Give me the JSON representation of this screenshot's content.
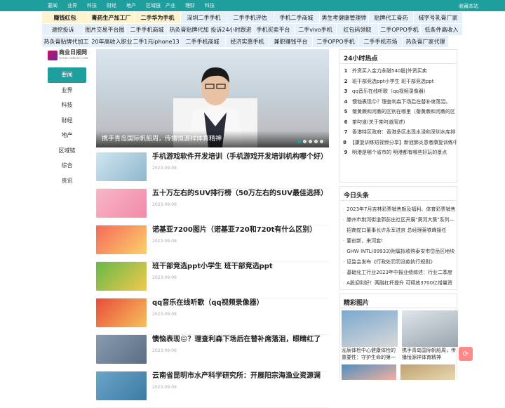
{
  "topbar": {
    "nav": [
      "要闻",
      "业界",
      "科技",
      "财经",
      "地产",
      "区域链",
      "产业",
      "理财",
      "科技"
    ],
    "favorite": "收藏本站"
  },
  "hot_links": [
    [
      {
        "t": "赚钱红包",
        "b": true,
        "w": 66
      },
      {
        "t": "膏药生产加工厂",
        "b": true,
        "w": 66
      },
      {
        "t": "二手华为手机",
        "b": true,
        "w": 66
      },
      {
        "t": "深圳二手手机",
        "w": 66
      },
      {
        "t": "二手手机评估",
        "w": 66
      },
      {
        "t": "手机二手商城",
        "w": 66
      },
      {
        "t": "男生考健康管理师",
        "w": 70
      },
      {
        "t": "贴牌代工膏药",
        "w": 64
      },
      {
        "t": "械字号乳膏厂家",
        "w": 70
      }
    ],
    [
      {
        "t": "速挖投诉",
        "w": 60
      },
      {
        "t": "图片交易平台图",
        "w": 60
      },
      {
        "t": "二手手机商城",
        "w": 60
      },
      {
        "t": "热灸膏贴牌代加",
        "w": 60
      },
      {
        "t": "投诉24小时跟进",
        "w": 60
      },
      {
        "t": "手机买卖平台",
        "w": 60
      },
      {
        "t": "二手vivo手机",
        "w": 60
      },
      {
        "t": "红包码领取",
        "w": 60
      },
      {
        "t": "二手OPPO手机",
        "w": 60
      },
      {
        "t": "低条件高收入",
        "w": 60
      }
    ],
    [
      {
        "t": "热灸膏贴牌代加工",
        "w": 70
      },
      {
        "t": "20年高收入职业",
        "w": 60
      },
      {
        "t": "二手1元iphone13",
        "w": 66
      },
      {
        "t": "二手手机商城",
        "w": 66
      },
      {
        "t": "经济实惠手机",
        "w": 62
      },
      {
        "t": "兼职赚钱平台",
        "w": 62
      },
      {
        "t": "二手OPPO手机",
        "w": 66
      },
      {
        "t": "二手手机市场",
        "w": 62
      },
      {
        "t": "热灸膏厂家代理",
        "w": 66
      }
    ]
  ],
  "logo": {
    "name": "商业日报网",
    "url": "www.cnbsw.com"
  },
  "sidebar": [
    "要闻",
    "业界",
    "科技",
    "财经",
    "地产",
    "区域链",
    "综合",
    "资讯"
  ],
  "slider": {
    "caption": "携手青岛国际帆船周，传播恒源祥体育精神"
  },
  "articles": [
    {
      "title": "手机游戏软件开发培训（手机游戏开发培训机构哪个好）",
      "date": "2023-09-09",
      "c1": "#cfe6f2",
      "c2": "#8fb7cc"
    },
    {
      "title": "五十万左右的SUV排行榜（50万左右的SUV最佳选择）",
      "date": "2023-09-09",
      "c1": "#f8b6c8",
      "c2": "#f28aa8"
    },
    {
      "title": "诺基亚7200图片（诺基亚720和720t有什么区别）",
      "date": "2023-09-09",
      "c1": "#f46a5a",
      "c2": "#fbd06a"
    },
    {
      "title": "班干部竞选ppt小学生 班干部竞选ppt",
      "date": "2023-09-09",
      "c1": "#66b84a",
      "c2": "#f2c94c"
    },
    {
      "title": "qq音乐在线听歌（qq视频录像器）",
      "date": "2023-09-09",
      "c1": "#e94b3c",
      "c2": "#f6c15b"
    },
    {
      "title": "懊恼表现😖？理查利森下场后在替补席落泪，眼睛红了",
      "date": "2023-09-09",
      "c1": "#8a9bb0",
      "c2": "#5a6e84"
    },
    {
      "title": "云南省昆明市水产科学研究所：开展阳宗海渔业资源调",
      "date": "2023-09-09",
      "c1": "#6aa5c9",
      "c2": "#3d7aa3"
    }
  ],
  "hot24": {
    "title": "24小时热点",
    "items": [
      "外资买入金力永磁540股|外资买卖",
      "班干部竞选ppt小学生 班干部竞选ppt",
      "qq音乐在线听歌（qq视频录像器）",
      "懊恼表现😖？理查利森下场后在替补席落泪，",
      "菊黄蕨和河蕨的区别在哪里（菊黄蕨和河蕨的区",
      "茶叼道(关于茶叼道简述)",
      "香港特区政府：香港多区出现水浸和深圳水库排",
      "【康复训练短视频分享】新冠肺炎患者康复训练中",
      "明港是哪个省市的 明港都有哪些好玩的景点"
    ]
  },
  "today": {
    "title": "今日头条",
    "items": [
      "2023年7月吉林彩票销售额及福利、体育彩票销售",
      "滕州市荆河街道郭彭庄社区开展\"黄河大集\"系列—",
      "招商蛇口董事长许永军进京 总经理蒋铁峰接任",
      "要创新，来河套!",
      "GHW INTL(09933)附属拟收购泰安市岱岳区地块",
      "证监会发布《行政处罚罚没款执行规则》",
      "基础化工行业2023年中报业绩综述：行业二季度",
      "A股迎利好！两融杠杆提升 可释放3700亿增量资"
    ]
  },
  "pics": {
    "title": "精彩图片",
    "items": [
      {
        "caption": "泓辰体检中心健康体检的重要性：守护生命的第一",
        "c1": "#7aa8cf",
        "c2": "#d9d9d9"
      },
      {
        "caption": "携手青岛国际帆船周，传播恒源祥体育精神",
        "c1": "#dfe6ec",
        "c2": "#9aa4ad"
      }
    ],
    "row2": [
      {
        "c1": "#4d8fc0",
        "c2": "#f4b0a0"
      },
      {
        "c1": "#bfa070",
        "c2": "#e8d8b0"
      }
    ]
  }
}
